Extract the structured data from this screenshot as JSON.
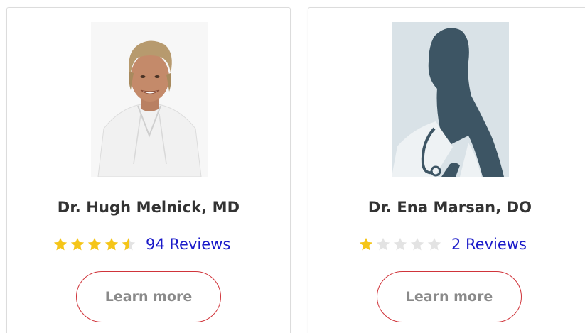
{
  "colors": {
    "star_filled": "#f5c518",
    "star_empty": "#e3e3e3",
    "review_link": "#1a1ac9",
    "button_border": "#d0343a",
    "button_text": "#8a8a8a",
    "name_text": "#333333"
  },
  "doctors": [
    {
      "name": "Dr. Hugh Melnick, MD",
      "rating": 4.5,
      "rating_max": 5,
      "reviews_label": "94 Reviews",
      "button_label": "Learn more",
      "photo_icon": "doctor-photo"
    },
    {
      "name": "Dr. Ena Marsan, DO",
      "rating": 1,
      "rating_max": 5,
      "reviews_label": "2 Reviews",
      "button_label": "Learn more",
      "photo_icon": "doctor-silhouette-placeholder"
    }
  ]
}
